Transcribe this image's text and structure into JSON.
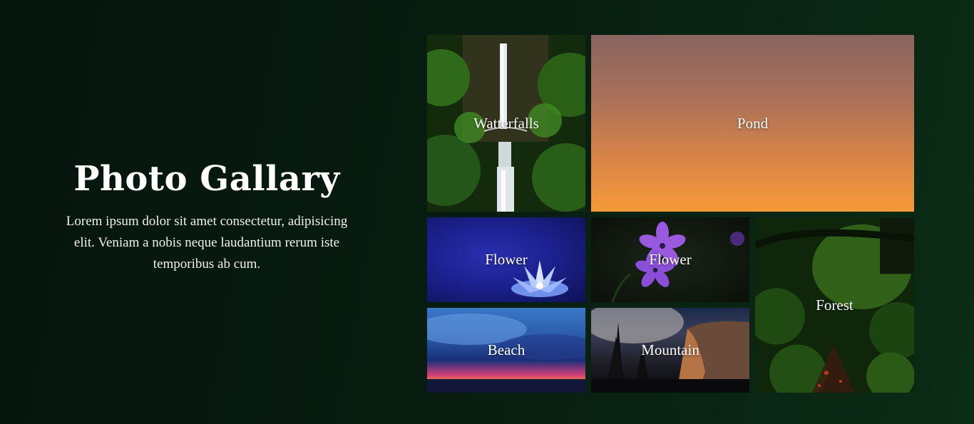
{
  "intro": {
    "title": "Photo Gallary",
    "description": "Lorem ipsum dolor sit amet consectetur, adipisicing elit. Veniam a nobis neque laudantium rerum iste temporibus ab cum."
  },
  "gallery": {
    "tiles": [
      {
        "label": "Watterfalls"
      },
      {
        "label": "Pond"
      },
      {
        "label": "Flower"
      },
      {
        "label": "Flower"
      },
      {
        "label": "Forest"
      },
      {
        "label": "Beach"
      },
      {
        "label": "Mountain"
      }
    ]
  },
  "colors": {
    "background": "#081d10",
    "text": "#ffffff"
  }
}
